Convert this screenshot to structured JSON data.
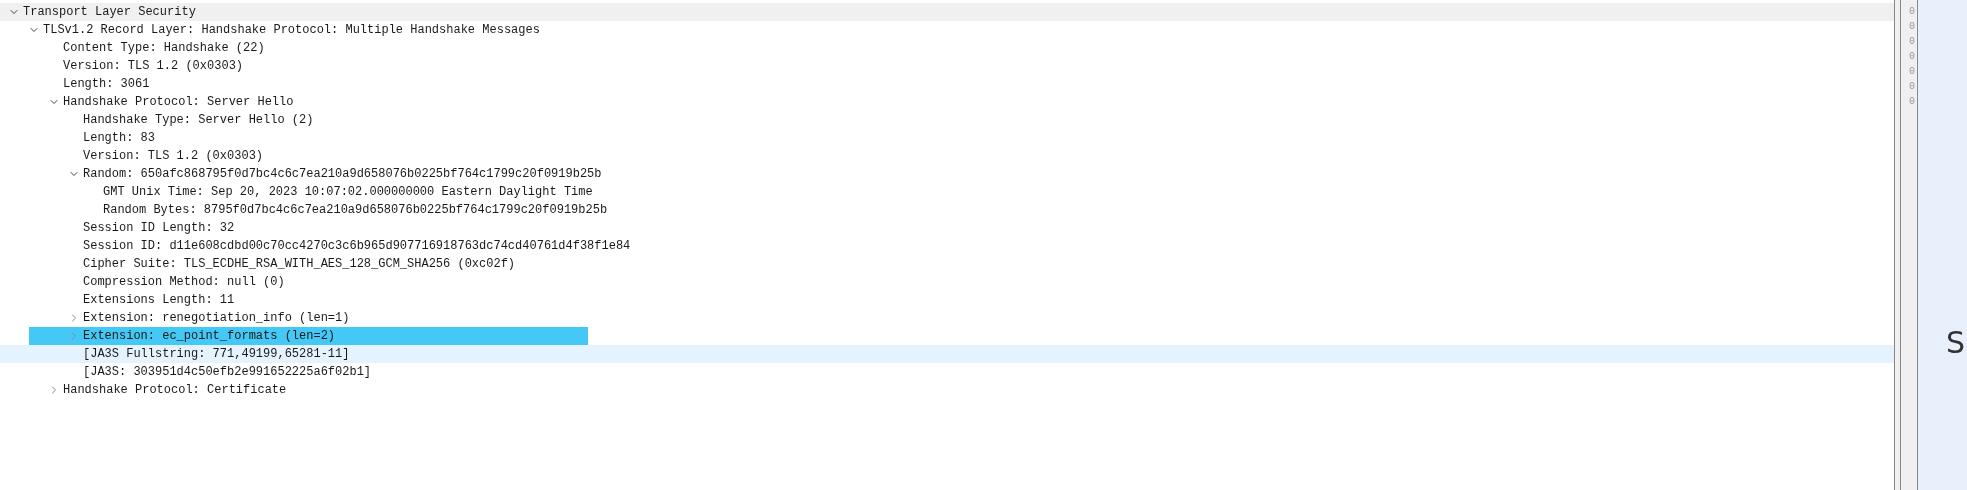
{
  "tree": [
    {
      "label": "Transport Layer Security",
      "expanded": true,
      "selected": false,
      "hovered": false,
      "shaded": true,
      "children": [
        {
          "label": "TLSv1.2 Record Layer: Handshake Protocol: Multiple Handshake Messages",
          "expanded": true,
          "selected": false,
          "hovered": false,
          "shaded": false,
          "children": [
            {
              "label": "Content Type: Handshake (22)",
              "selected": false,
              "hovered": false,
              "shaded": false
            },
            {
              "label": "Version: TLS 1.2 (0x0303)",
              "selected": false,
              "hovered": false,
              "shaded": false
            },
            {
              "label": "Length: 3061",
              "selected": false,
              "hovered": false,
              "shaded": false
            },
            {
              "label": "Handshake Protocol: Server Hello",
              "expanded": true,
              "selected": false,
              "hovered": false,
              "shaded": false,
              "children": [
                {
                  "label": "Handshake Type: Server Hello (2)",
                  "selected": false,
                  "hovered": false,
                  "shaded": false
                },
                {
                  "label": "Length: 83",
                  "selected": false,
                  "hovered": false,
                  "shaded": false
                },
                {
                  "label": "Version: TLS 1.2 (0x0303)",
                  "selected": false,
                  "hovered": false,
                  "shaded": false
                },
                {
                  "label": "Random: 650afc868795f0d7bc4c6c7ea210a9d658076b0225bf764c1799c20f0919b25b",
                  "expanded": true,
                  "selected": false,
                  "hovered": false,
                  "shaded": false,
                  "children": [
                    {
                      "label": "GMT Unix Time: Sep 20, 2023 10:07:02.000000000 Eastern Daylight Time",
                      "selected": false,
                      "hovered": false,
                      "shaded": false
                    },
                    {
                      "label": "Random Bytes: 8795f0d7bc4c6c7ea210a9d658076b0225bf764c1799c20f0919b25b",
                      "selected": false,
                      "hovered": false,
                      "shaded": false
                    }
                  ]
                },
                {
                  "label": "Session ID Length: 32",
                  "selected": false,
                  "hovered": false,
                  "shaded": false
                },
                {
                  "label": "Session ID: d11e608cdbd00c70cc4270c3c6b965d907716918763dc74cd40761d4f38f1e84",
                  "selected": false,
                  "hovered": false,
                  "shaded": false
                },
                {
                  "label": "Cipher Suite: TLS_ECDHE_RSA_WITH_AES_128_GCM_SHA256 (0xc02f)",
                  "selected": false,
                  "hovered": false,
                  "shaded": false
                },
                {
                  "label": "Compression Method: null (0)",
                  "selected": false,
                  "hovered": false,
                  "shaded": false
                },
                {
                  "label": "Extensions Length: 11",
                  "selected": false,
                  "hovered": false,
                  "shaded": false
                },
                {
                  "label": "Extension: renegotiation_info (len=1)",
                  "expanded": false,
                  "selected": false,
                  "hovered": false,
                  "shaded": false
                },
                {
                  "label": "Extension: ec_point_formats (len=2)",
                  "expanded": false,
                  "selected": true,
                  "hovered": false,
                  "shaded": false
                },
                {
                  "label": "[JA3S Fullstring: 771,49199,65281-11]",
                  "selected": false,
                  "hovered": true,
                  "shaded": false
                },
                {
                  "label": "[JA3S: 303951d4c50efb2e991652225a6f02b1]",
                  "selected": false,
                  "hovered": false,
                  "shaded": false
                }
              ]
            },
            {
              "label": "Handshake Protocol: Certificate",
              "expanded": false,
              "selected": false,
              "hovered": false,
              "shaded": false
            }
          ]
        }
      ]
    }
  ],
  "hex_offsets": [
    "0",
    "0",
    "0",
    "0",
    "0",
    "0",
    "0"
  ],
  "side_panel_text": "S"
}
